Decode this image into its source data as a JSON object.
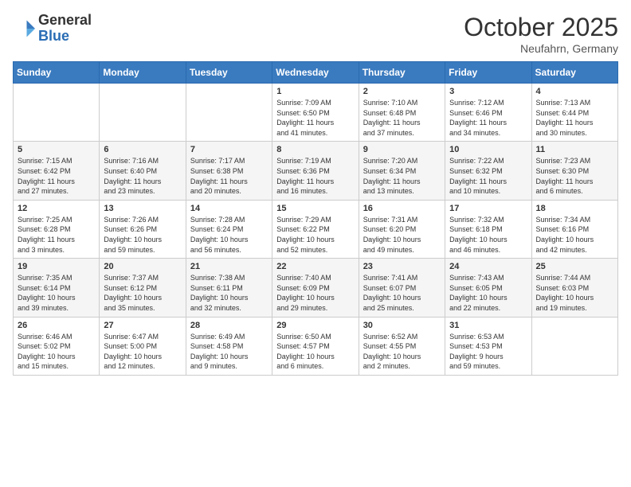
{
  "header": {
    "logo_general": "General",
    "logo_blue": "Blue",
    "month_title": "October 2025",
    "location": "Neufahrn, Germany"
  },
  "weekdays": [
    "Sunday",
    "Monday",
    "Tuesday",
    "Wednesday",
    "Thursday",
    "Friday",
    "Saturday"
  ],
  "weeks": [
    [
      {
        "day": "",
        "info": ""
      },
      {
        "day": "",
        "info": ""
      },
      {
        "day": "",
        "info": ""
      },
      {
        "day": "1",
        "info": "Sunrise: 7:09 AM\nSunset: 6:50 PM\nDaylight: 11 hours\nand 41 minutes."
      },
      {
        "day": "2",
        "info": "Sunrise: 7:10 AM\nSunset: 6:48 PM\nDaylight: 11 hours\nand 37 minutes."
      },
      {
        "day": "3",
        "info": "Sunrise: 7:12 AM\nSunset: 6:46 PM\nDaylight: 11 hours\nand 34 minutes."
      },
      {
        "day": "4",
        "info": "Sunrise: 7:13 AM\nSunset: 6:44 PM\nDaylight: 11 hours\nand 30 minutes."
      }
    ],
    [
      {
        "day": "5",
        "info": "Sunrise: 7:15 AM\nSunset: 6:42 PM\nDaylight: 11 hours\nand 27 minutes."
      },
      {
        "day": "6",
        "info": "Sunrise: 7:16 AM\nSunset: 6:40 PM\nDaylight: 11 hours\nand 23 minutes."
      },
      {
        "day": "7",
        "info": "Sunrise: 7:17 AM\nSunset: 6:38 PM\nDaylight: 11 hours\nand 20 minutes."
      },
      {
        "day": "8",
        "info": "Sunrise: 7:19 AM\nSunset: 6:36 PM\nDaylight: 11 hours\nand 16 minutes."
      },
      {
        "day": "9",
        "info": "Sunrise: 7:20 AM\nSunset: 6:34 PM\nDaylight: 11 hours\nand 13 minutes."
      },
      {
        "day": "10",
        "info": "Sunrise: 7:22 AM\nSunset: 6:32 PM\nDaylight: 11 hours\nand 10 minutes."
      },
      {
        "day": "11",
        "info": "Sunrise: 7:23 AM\nSunset: 6:30 PM\nDaylight: 11 hours\nand 6 minutes."
      }
    ],
    [
      {
        "day": "12",
        "info": "Sunrise: 7:25 AM\nSunset: 6:28 PM\nDaylight: 11 hours\nand 3 minutes."
      },
      {
        "day": "13",
        "info": "Sunrise: 7:26 AM\nSunset: 6:26 PM\nDaylight: 10 hours\nand 59 minutes."
      },
      {
        "day": "14",
        "info": "Sunrise: 7:28 AM\nSunset: 6:24 PM\nDaylight: 10 hours\nand 56 minutes."
      },
      {
        "day": "15",
        "info": "Sunrise: 7:29 AM\nSunset: 6:22 PM\nDaylight: 10 hours\nand 52 minutes."
      },
      {
        "day": "16",
        "info": "Sunrise: 7:31 AM\nSunset: 6:20 PM\nDaylight: 10 hours\nand 49 minutes."
      },
      {
        "day": "17",
        "info": "Sunrise: 7:32 AM\nSunset: 6:18 PM\nDaylight: 10 hours\nand 46 minutes."
      },
      {
        "day": "18",
        "info": "Sunrise: 7:34 AM\nSunset: 6:16 PM\nDaylight: 10 hours\nand 42 minutes."
      }
    ],
    [
      {
        "day": "19",
        "info": "Sunrise: 7:35 AM\nSunset: 6:14 PM\nDaylight: 10 hours\nand 39 minutes."
      },
      {
        "day": "20",
        "info": "Sunrise: 7:37 AM\nSunset: 6:12 PM\nDaylight: 10 hours\nand 35 minutes."
      },
      {
        "day": "21",
        "info": "Sunrise: 7:38 AM\nSunset: 6:11 PM\nDaylight: 10 hours\nand 32 minutes."
      },
      {
        "day": "22",
        "info": "Sunrise: 7:40 AM\nSunset: 6:09 PM\nDaylight: 10 hours\nand 29 minutes."
      },
      {
        "day": "23",
        "info": "Sunrise: 7:41 AM\nSunset: 6:07 PM\nDaylight: 10 hours\nand 25 minutes."
      },
      {
        "day": "24",
        "info": "Sunrise: 7:43 AM\nSunset: 6:05 PM\nDaylight: 10 hours\nand 22 minutes."
      },
      {
        "day": "25",
        "info": "Sunrise: 7:44 AM\nSunset: 6:03 PM\nDaylight: 10 hours\nand 19 minutes."
      }
    ],
    [
      {
        "day": "26",
        "info": "Sunrise: 6:46 AM\nSunset: 5:02 PM\nDaylight: 10 hours\nand 15 minutes."
      },
      {
        "day": "27",
        "info": "Sunrise: 6:47 AM\nSunset: 5:00 PM\nDaylight: 10 hours\nand 12 minutes."
      },
      {
        "day": "28",
        "info": "Sunrise: 6:49 AM\nSunset: 4:58 PM\nDaylight: 10 hours\nand 9 minutes."
      },
      {
        "day": "29",
        "info": "Sunrise: 6:50 AM\nSunset: 4:57 PM\nDaylight: 10 hours\nand 6 minutes."
      },
      {
        "day": "30",
        "info": "Sunrise: 6:52 AM\nSunset: 4:55 PM\nDaylight: 10 hours\nand 2 minutes."
      },
      {
        "day": "31",
        "info": "Sunrise: 6:53 AM\nSunset: 4:53 PM\nDaylight: 9 hours\nand 59 minutes."
      },
      {
        "day": "",
        "info": ""
      }
    ]
  ]
}
